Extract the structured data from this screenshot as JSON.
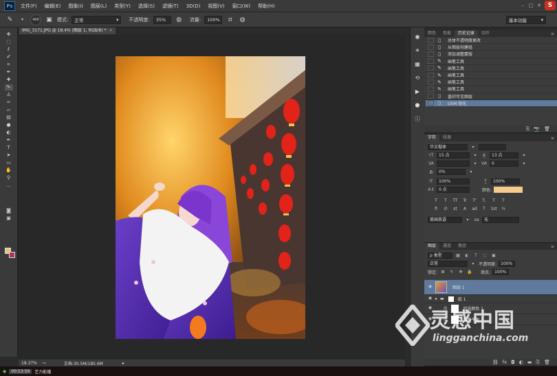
{
  "app": {
    "logo": "Ps"
  },
  "menu": [
    "文件(F)",
    "编辑(E)",
    "图像(I)",
    "图层(L)",
    "类型(Y)",
    "选择(S)",
    "滤镜(T)",
    "3D(D)",
    "视图(V)",
    "窗口(W)",
    "帮助(H)"
  ],
  "options": {
    "brush_size": "400",
    "mode_label": "模式:",
    "mode_value": "正常",
    "opacity_label": "不透明度:",
    "opacity_value": "35%",
    "flow_label": "流量:",
    "flow_value": "100%",
    "workspace": "基本功能"
  },
  "document": {
    "tab_title": "IMG_3171.JPG @ 18.4% (图层 1, RGB/8) *"
  },
  "history": {
    "tabs": [
      "颜色",
      "色板",
      "历史记录",
      "动作"
    ],
    "active_tab": "历史记录",
    "items": [
      {
        "label": "总体不透明度更改",
        "icon": "doc"
      },
      {
        "label": "从图层创建组",
        "icon": "doc"
      },
      {
        "label": "添加调整蒙版",
        "icon": "doc"
      },
      {
        "label": "画笔工具",
        "icon": "brush"
      },
      {
        "label": "画笔工具",
        "icon": "brush"
      },
      {
        "label": "画笔工具",
        "icon": "brush"
      },
      {
        "label": "画笔工具",
        "icon": "brush"
      },
      {
        "label": "画笔工具",
        "icon": "brush"
      },
      {
        "label": "盖印可见图层",
        "icon": "doc"
      },
      {
        "label": "USM 锐化",
        "icon": "doc"
      }
    ]
  },
  "character": {
    "tabs": [
      "字符",
      "段落"
    ],
    "font_family": "华文楷体",
    "font_size": "15 点",
    "leading": "13 点",
    "kerning": "",
    "tracking": "0",
    "tsume": "0%",
    "vscale": "100%",
    "hscale": "100%",
    "baseline": "0 点",
    "color_label": "颜色:",
    "color_hex": "#f6c98d",
    "styles": [
      "T",
      "T",
      "TT",
      "Tr",
      "T'",
      "T,",
      "T",
      "T"
    ],
    "extras": [
      "fi",
      "∅",
      "st",
      "A",
      "ad",
      "T",
      "1st",
      "½"
    ],
    "language": "美国英语",
    "aa_label": "aa",
    "aa_value": "无"
  },
  "layers": {
    "tabs": [
      "图层",
      "通道",
      "路径"
    ],
    "filter_kind": "ρ 类型",
    "blend_mode": "正常",
    "opacity_label": "不透明度:",
    "opacity_value": "100%",
    "lock_label": "锁定:",
    "fill_label": "填充:",
    "fill_value": "100%",
    "items": [
      {
        "name": "图层 1",
        "selected": true
      },
      {
        "name": "组 1",
        "selected": false
      },
      {
        "name": "可选颜色 1",
        "selected": false
      },
      {
        "name": "色彩平衡 1",
        "selected": false
      }
    ]
  },
  "status": {
    "zoom": "18.37%",
    "doc": "文档:30.5M/185.6M"
  },
  "taskbar": {
    "time": "00:53:59",
    "label": "艺力能播"
  },
  "watermark": {
    "brand": "灵感中国",
    "url": "lingganchina.com"
  }
}
